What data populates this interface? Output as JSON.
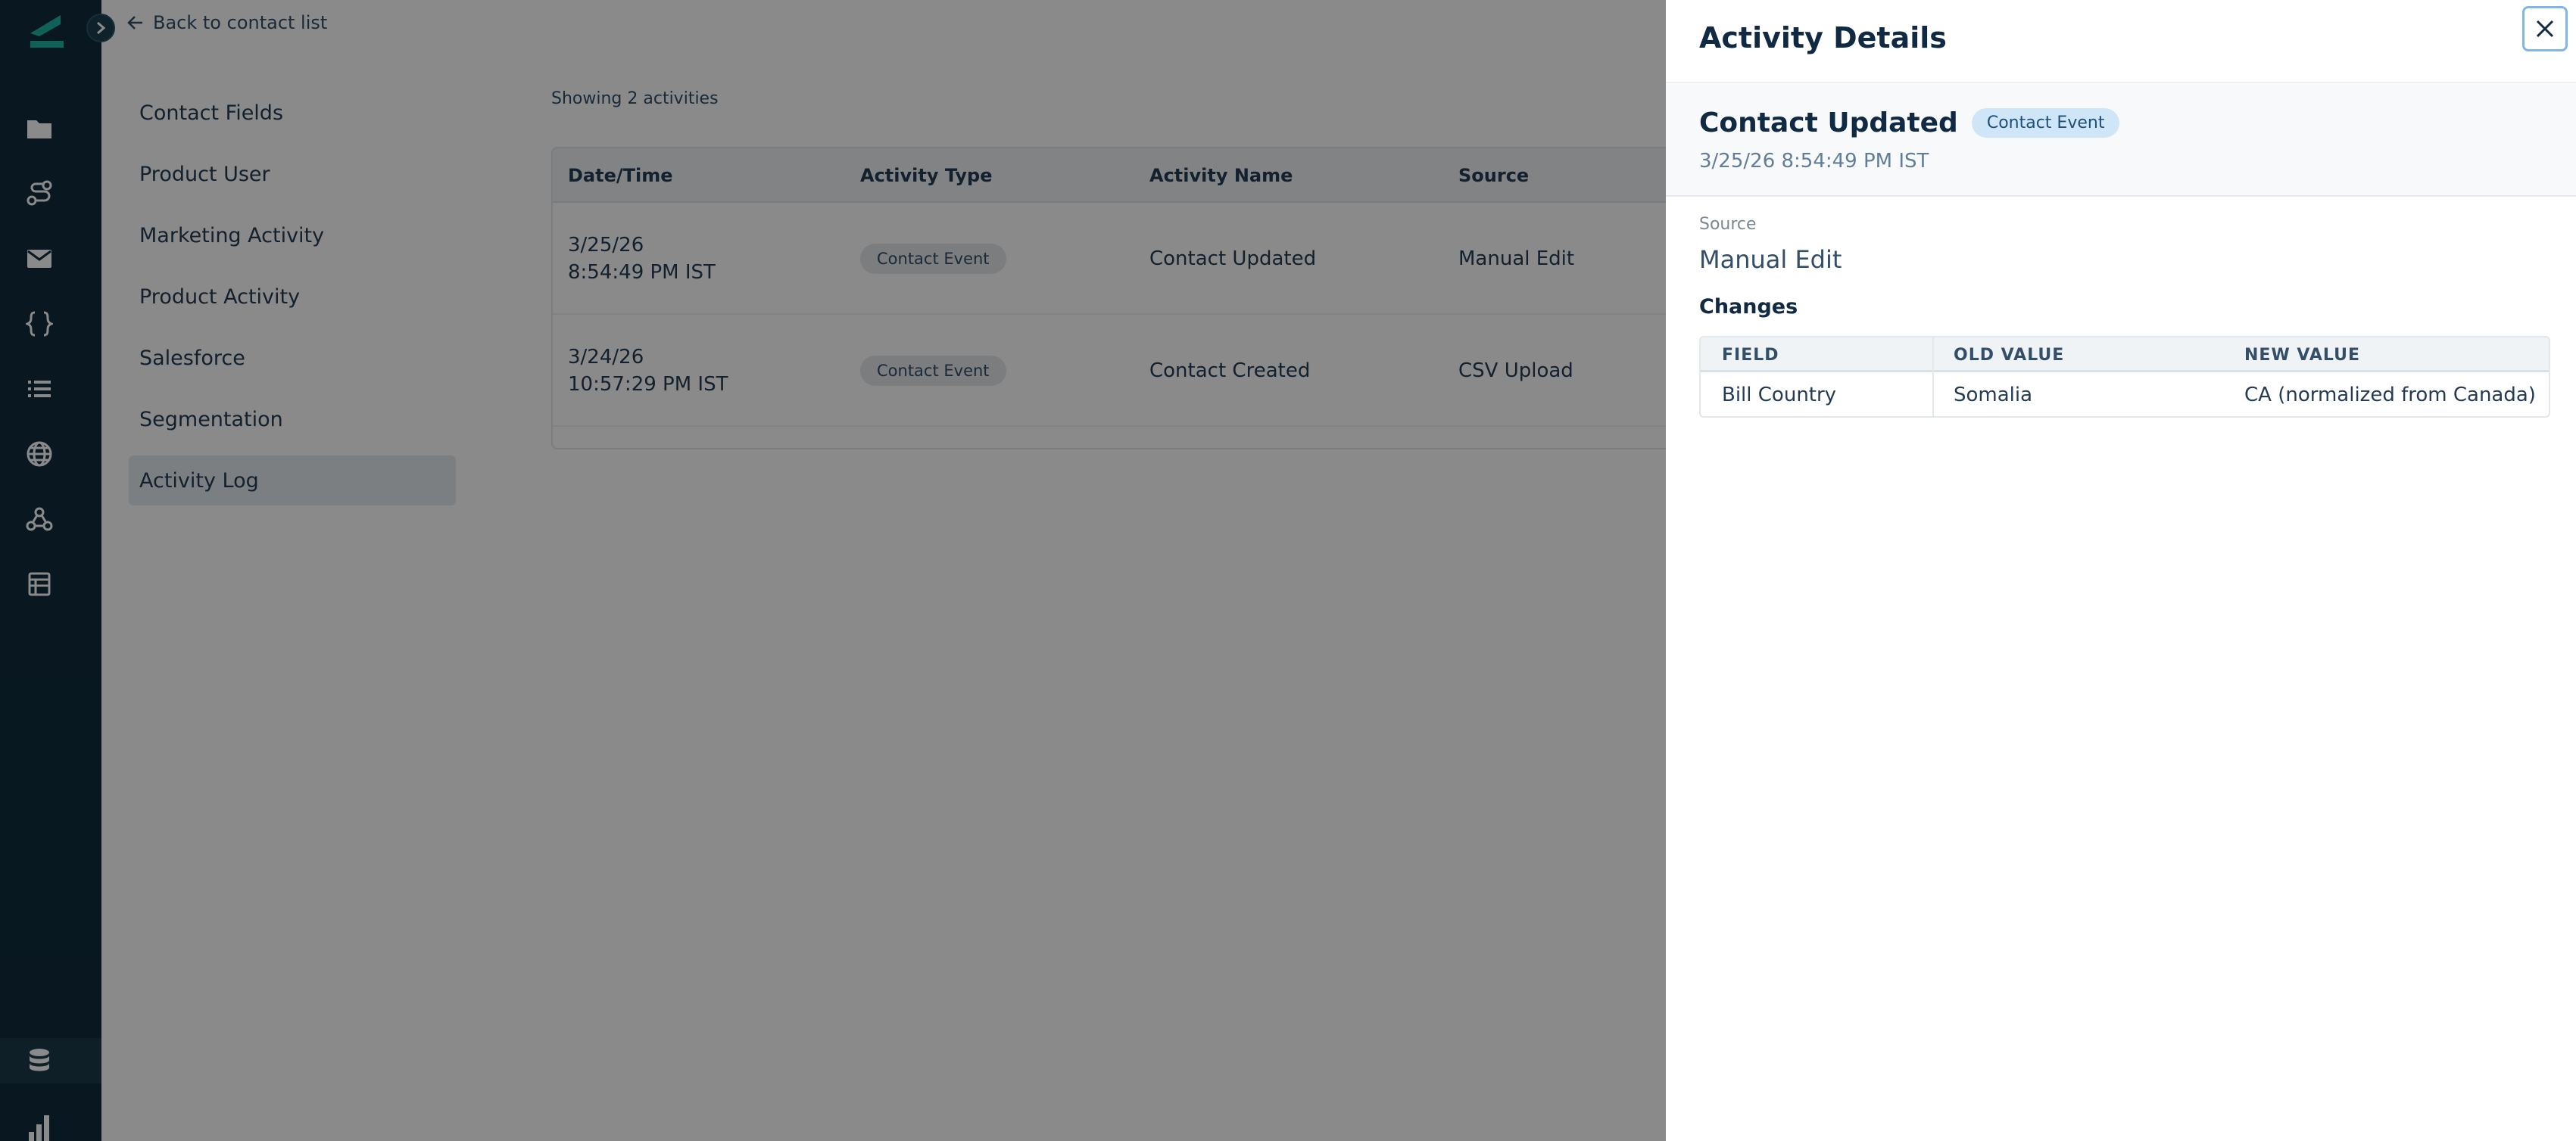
{
  "main": {
    "back_link": "Back to contact list",
    "subnav": [
      {
        "label": "Contact Fields"
      },
      {
        "label": "Product User"
      },
      {
        "label": "Marketing Activity"
      },
      {
        "label": "Product Activity"
      },
      {
        "label": "Salesforce"
      },
      {
        "label": "Segmentation"
      },
      {
        "label": "Activity Log"
      }
    ],
    "active_subnav": "Activity Log",
    "showing": "Showing 2 activities",
    "table": {
      "headers": [
        "Date/Time",
        "Activity Type",
        "Activity Name",
        "Source"
      ],
      "rows": [
        {
          "date": "3/25/26",
          "time": "8:54:49 PM IST",
          "type": "Contact Event",
          "name": "Contact Updated",
          "source": "Manual Edit"
        },
        {
          "date": "3/24/26",
          "time": "10:57:29 PM IST",
          "type": "Contact Event",
          "name": "Contact Created",
          "source": "CSV Upload"
        }
      ]
    }
  },
  "drawer": {
    "title": "Activity Details",
    "activity_name": "Contact Updated",
    "badge": "Contact Event",
    "timestamp": "3/25/26 8:54:49 PM IST",
    "source_label": "Source",
    "source_value": "Manual Edit",
    "changes_title": "Changes",
    "changes": {
      "headers": [
        "FIELD",
        "OLD VALUE",
        "NEW VALUE"
      ],
      "rows": [
        {
          "field": "Bill Country",
          "old": "Somalia",
          "new": "CA (normalized from Canada)"
        }
      ]
    }
  },
  "colors": {
    "rail_bg": "#0f2c3c",
    "brand_teal": "#1fb5a3",
    "overlay": "rgba(0,0,0,0.46)",
    "badge_blue": "#cfe6f8",
    "focus_ring": "#7fb5e8"
  },
  "icons": [
    "app-logo-icon",
    "chevron-right-icon",
    "folder-icon",
    "journey-icon",
    "mail-icon",
    "braces-icon",
    "list-icon",
    "globe-icon",
    "webhook-icon",
    "table-icon",
    "database-icon",
    "bar-chart-icon",
    "arrow-left-icon",
    "close-icon"
  ]
}
